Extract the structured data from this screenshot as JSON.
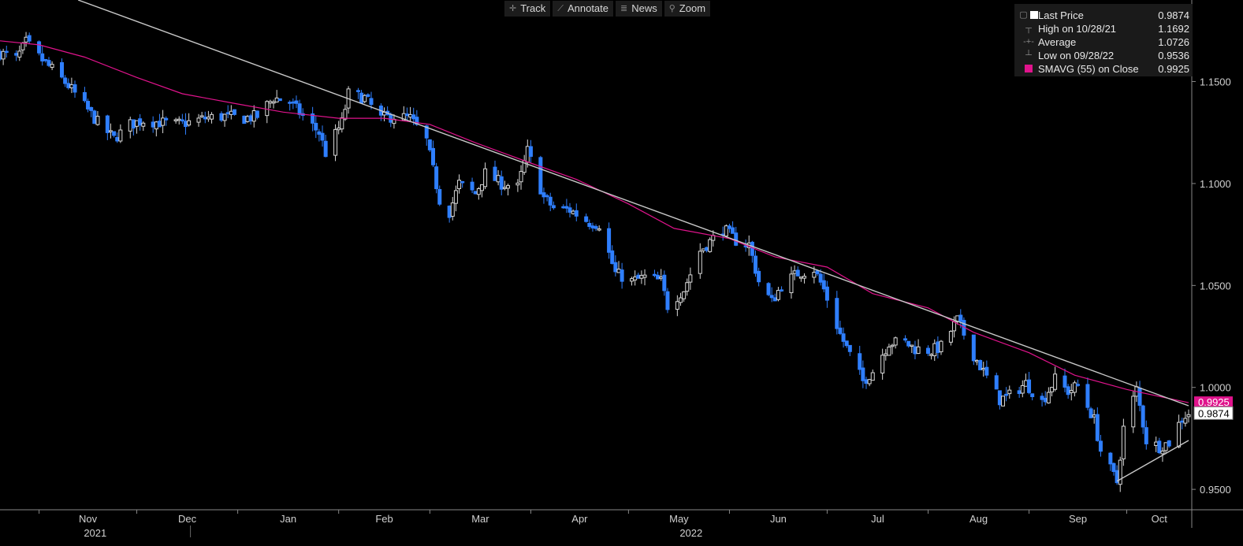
{
  "toolbar": {
    "items": [
      {
        "label": "Track",
        "icon": "crosshair-icon"
      },
      {
        "label": "Annotate",
        "icon": "pencil-icon"
      },
      {
        "label": "News",
        "icon": "news-icon"
      },
      {
        "label": "Zoom",
        "icon": "zoom-icon"
      }
    ]
  },
  "legend": {
    "rows": [
      {
        "label": "Last Price",
        "value": "0.9874",
        "marker": "white-square"
      },
      {
        "label": "High on 10/28/21",
        "value": "1.1692",
        "marker": "high-marker"
      },
      {
        "label": "Average",
        "value": "1.0726",
        "marker": "average-marker"
      },
      {
        "label": "Low on 09/28/22",
        "value": "0.9536",
        "marker": "low-marker"
      },
      {
        "label": "SMAVG (55)  on Close",
        "value": "0.9925",
        "marker": "magenta-square"
      }
    ]
  },
  "colors": {
    "background": "#000000",
    "bearish": "#2f7fff",
    "bullish": "#d9d9d9",
    "sma": "#e0138c",
    "trendline": "#c8c8c8",
    "axis_text": "#d0d0d0"
  },
  "chart_data": {
    "type": "candlestick",
    "title": "",
    "x_axis": {
      "months": [
        "Nov",
        "Dec",
        "Jan",
        "Feb",
        "Mar",
        "Apr",
        "May",
        "Jun",
        "Jul",
        "Aug",
        "Sep",
        "Oct"
      ],
      "years": [
        "2021",
        "2022"
      ],
      "range": [
        "2021-10-20",
        "2022-10-20"
      ]
    },
    "y_axis": {
      "ticks": [
        "1.1500",
        "1.1000",
        "1.0500",
        "1.0000",
        "0.9500"
      ],
      "range": [
        0.94,
        1.19
      ],
      "position": "right"
    },
    "last_price_label": "0.9874",
    "sma_label": "0.9925",
    "series": [
      {
        "name": "Last Price",
        "style": "candles",
        "points": [
          [
            "2021-10-20",
            1.164
          ],
          [
            "2021-10-25",
            1.161
          ],
          [
            "2021-10-28",
            1.1692
          ],
          [
            "2021-11-01",
            1.162
          ],
          [
            "2021-11-05",
            1.156
          ],
          [
            "2021-11-10",
            1.148
          ],
          [
            "2021-11-15",
            1.138
          ],
          [
            "2021-11-19",
            1.13
          ],
          [
            "2021-11-24",
            1.122
          ],
          [
            "2021-11-29",
            1.129
          ],
          [
            "2021-12-03",
            1.131
          ],
          [
            "2021-12-08",
            1.13
          ],
          [
            "2021-12-13",
            1.129
          ],
          [
            "2021-12-17",
            1.13
          ],
          [
            "2021-12-22",
            1.132
          ],
          [
            "2021-12-28",
            1.133
          ],
          [
            "2022-01-03",
            1.132
          ],
          [
            "2022-01-07",
            1.133
          ],
          [
            "2022-01-12",
            1.142
          ],
          [
            "2022-01-17",
            1.14
          ],
          [
            "2022-01-21",
            1.133
          ],
          [
            "2022-01-26",
            1.125
          ],
          [
            "2022-01-28",
            1.115
          ],
          [
            "2022-02-02",
            1.13
          ],
          [
            "2022-02-04",
            1.144
          ],
          [
            "2022-02-09",
            1.142
          ],
          [
            "2022-02-14",
            1.132
          ],
          [
            "2022-02-18",
            1.133
          ],
          [
            "2022-02-23",
            1.132
          ],
          [
            "2022-02-28",
            1.121
          ],
          [
            "2022-03-04",
            1.092
          ],
          [
            "2022-03-07",
            1.086
          ],
          [
            "2022-03-10",
            1.1
          ],
          [
            "2022-03-15",
            1.095
          ],
          [
            "2022-03-18",
            1.105
          ],
          [
            "2022-03-23",
            1.1
          ],
          [
            "2022-03-28",
            1.098
          ],
          [
            "2022-03-31",
            1.116
          ],
          [
            "2022-04-05",
            1.093
          ],
          [
            "2022-04-08",
            1.088
          ],
          [
            "2022-04-13",
            1.087
          ],
          [
            "2022-04-19",
            1.081
          ],
          [
            "2022-04-22",
            1.08
          ],
          [
            "2022-04-27",
            1.056
          ],
          [
            "2022-05-02",
            1.052
          ],
          [
            "2022-05-06",
            1.054
          ],
          [
            "2022-05-11",
            1.052
          ],
          [
            "2022-05-13",
            1.04
          ],
          [
            "2022-05-18",
            1.048
          ],
          [
            "2022-05-23",
            1.067
          ],
          [
            "2022-05-27",
            1.073
          ],
          [
            "2022-05-30",
            1.078
          ],
          [
            "2022-06-03",
            1.072
          ],
          [
            "2022-06-07",
            1.07
          ],
          [
            "2022-06-10",
            1.052
          ],
          [
            "2022-06-14",
            1.042
          ],
          [
            "2022-06-17",
            1.05
          ],
          [
            "2022-06-22",
            1.056
          ],
          [
            "2022-06-27",
            1.058
          ],
          [
            "2022-06-30",
            1.048
          ],
          [
            "2022-07-05",
            1.026
          ],
          [
            "2022-07-08",
            1.016
          ],
          [
            "2022-07-12",
            1.003
          ],
          [
            "2022-07-15",
            1.008
          ],
          [
            "2022-07-20",
            1.022
          ],
          [
            "2022-07-25",
            1.022
          ],
          [
            "2022-07-28",
            1.019
          ],
          [
            "2022-08-02",
            1.018
          ],
          [
            "2022-08-05",
            1.02
          ],
          [
            "2022-08-10",
            1.033
          ],
          [
            "2022-08-15",
            1.016
          ],
          [
            "2022-08-19",
            1.005
          ],
          [
            "2022-08-23",
            0.994
          ],
          [
            "2022-08-26",
            0.996
          ],
          [
            "2022-08-31",
            1.002
          ],
          [
            "2022-09-05",
            0.993
          ],
          [
            "2022-09-09",
            1.004
          ],
          [
            "2022-09-13",
            0.998
          ],
          [
            "2022-09-16",
            1.001
          ],
          [
            "2022-09-21",
            0.984
          ],
          [
            "2022-09-23",
            0.969
          ],
          [
            "2022-09-28",
            0.9536
          ],
          [
            "2022-09-30",
            0.98
          ],
          [
            "2022-10-04",
            0.999
          ],
          [
            "2022-10-07",
            0.974
          ],
          [
            "2022-10-11",
            0.971
          ],
          [
            "2022-10-14",
            0.973
          ],
          [
            "2022-10-18",
            0.985
          ],
          [
            "2022-10-20",
            0.9874
          ]
        ]
      },
      {
        "name": "SMAVG (55)  on Close",
        "style": "line",
        "points": [
          [
            "2021-10-20",
            1.17
          ],
          [
            "2021-11-01",
            1.168
          ],
          [
            "2021-11-15",
            1.162
          ],
          [
            "2021-12-01",
            1.152
          ],
          [
            "2021-12-15",
            1.144
          ],
          [
            "2022-01-01",
            1.139
          ],
          [
            "2022-01-15",
            1.135
          ],
          [
            "2022-02-01",
            1.132
          ],
          [
            "2022-02-15",
            1.132
          ],
          [
            "2022-03-01",
            1.129
          ],
          [
            "2022-03-15",
            1.12
          ],
          [
            "2022-04-01",
            1.11
          ],
          [
            "2022-04-15",
            1.102
          ],
          [
            "2022-05-01",
            1.09
          ],
          [
            "2022-05-15",
            1.078
          ],
          [
            "2022-06-01",
            1.073
          ],
          [
            "2022-06-15",
            1.064
          ],
          [
            "2022-07-01",
            1.059
          ],
          [
            "2022-07-15",
            1.046
          ],
          [
            "2022-08-01",
            1.039
          ],
          [
            "2022-08-15",
            1.027
          ],
          [
            "2022-09-01",
            1.017
          ],
          [
            "2022-09-15",
            1.006
          ],
          [
            "2022-10-01",
            0.999
          ],
          [
            "2022-10-20",
            0.9925
          ]
        ]
      },
      {
        "name": "Resistance trendline",
        "style": "trend",
        "points": [
          [
            "2021-11-13",
            1.19
          ],
          [
            "2022-10-20",
            0.991
          ]
        ]
      },
      {
        "name": "Support trendline",
        "style": "trend",
        "points": [
          [
            "2022-09-28",
            0.954
          ],
          [
            "2022-10-20",
            0.974
          ]
        ]
      }
    ]
  }
}
